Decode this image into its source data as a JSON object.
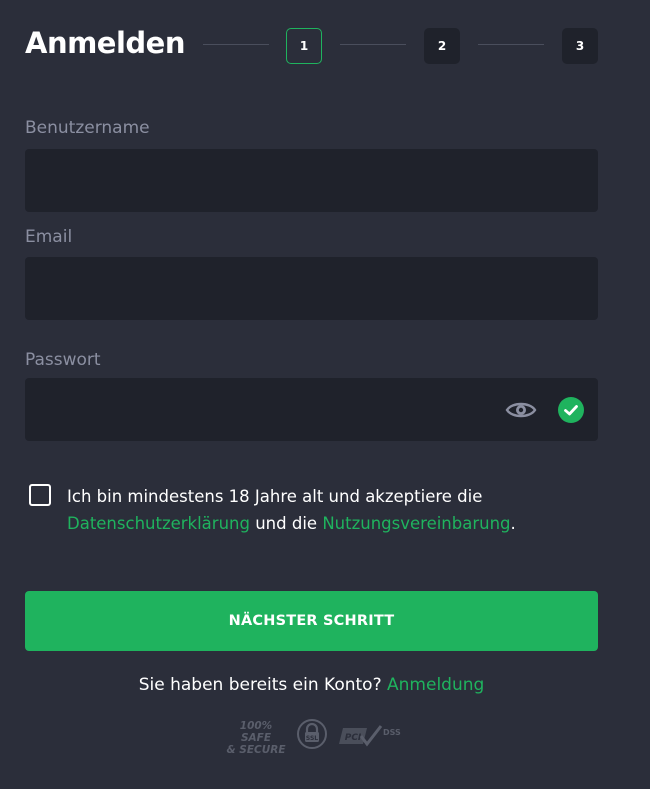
{
  "header": {
    "title": "Anmelden",
    "steps": [
      "1",
      "2",
      "3"
    ],
    "active_step": 1
  },
  "form": {
    "username_label": "Benutzername",
    "email_label": "Email",
    "password_label": "Passwort",
    "username_value": "",
    "email_value": "",
    "password_value": ""
  },
  "agreement": {
    "text_before": "Ich bin mindestens 18 Jahre alt und akzeptiere die ",
    "privacy_link": "Datenschutzerklärung",
    "text_middle": " und die ",
    "terms_link": "Nutzungsvereinbarung",
    "text_after": ".",
    "checked": false
  },
  "next_button_label": "NÄCHSTER SCHRITT",
  "login_prompt": {
    "text": "Sie haben bereits ein Konto?",
    "link": "Anmeldung"
  },
  "badges": {
    "safe_line1": "100% SAFE",
    "safe_line2": "& SECURE",
    "ssl_text": "SSL",
    "pci_text": "PCI",
    "dss_text": "DSS"
  },
  "colors": {
    "background": "#2b2e3a",
    "field": "#1f222b",
    "accent": "#1fb35e",
    "label": "#8b8fa1"
  },
  "icons": {
    "password_toggle": "eye-icon",
    "password_valid": "check-circle-icon"
  }
}
